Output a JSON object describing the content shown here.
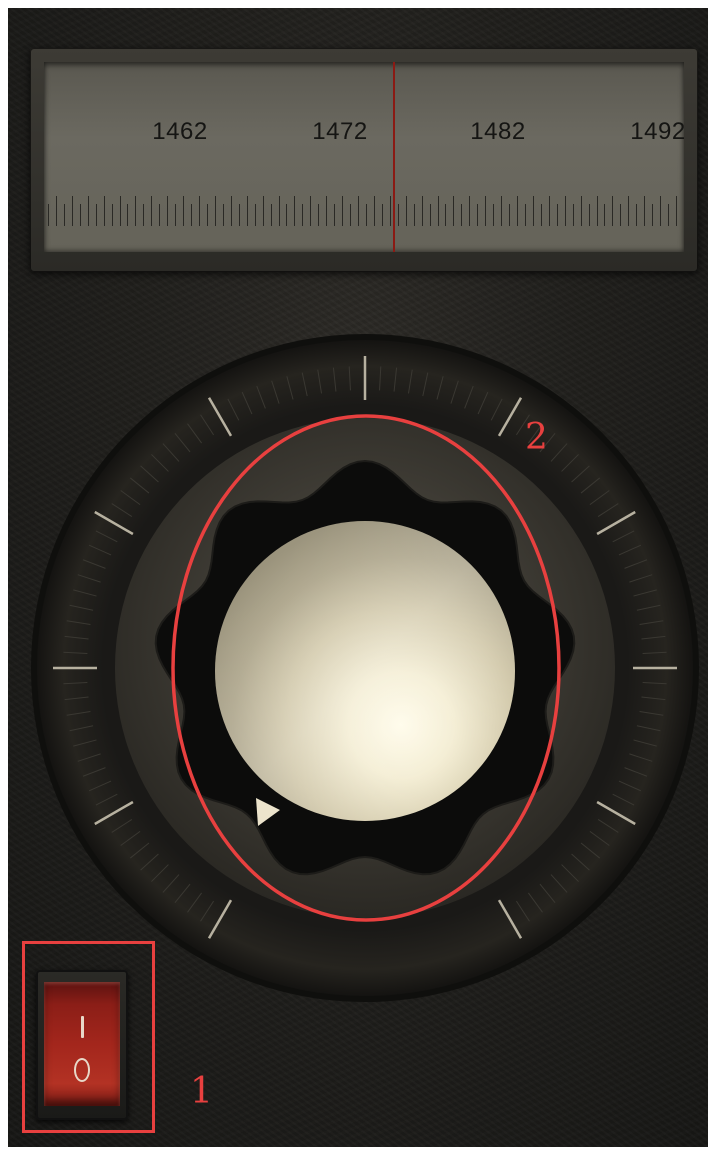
{
  "tuner": {
    "frequency_labels": [
      "1462",
      "1472",
      "1482",
      "1492"
    ]
  },
  "dial": {
    "knob_icon": "rotary-knob-icon",
    "pointer_icon": "triangle-pointer-icon"
  },
  "power_switch": {
    "on_symbol": "I",
    "off_symbol": "O",
    "state": "off"
  },
  "annotations": [
    {
      "label": "1",
      "target": "power-switch"
    },
    {
      "label": "2",
      "target": "tuning-knob"
    }
  ],
  "colors": {
    "annotation": "#e8403f",
    "needle": "#8b1a14",
    "switch": "#a3261c"
  }
}
